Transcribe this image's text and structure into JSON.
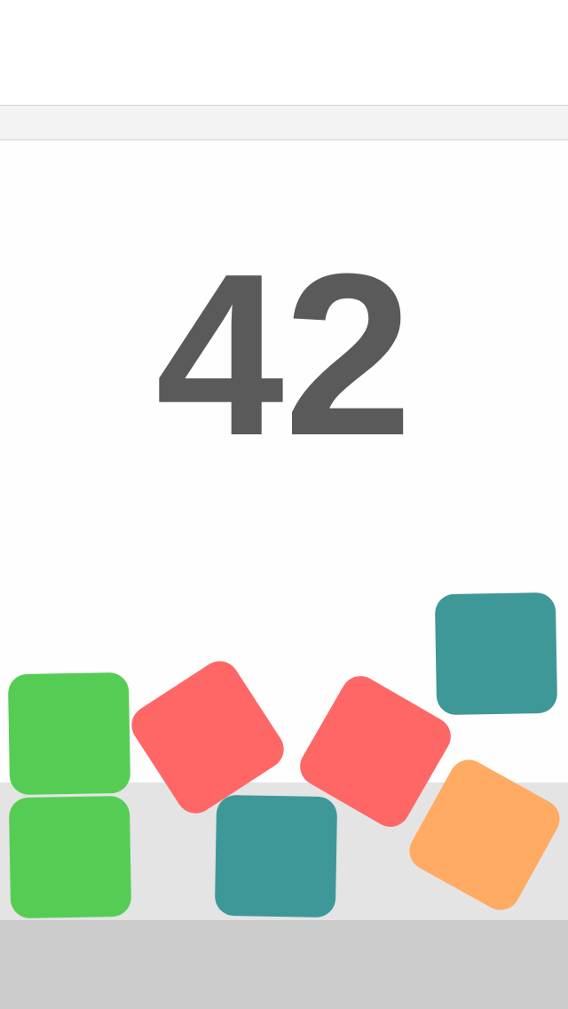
{
  "game": {
    "score": "42"
  },
  "colors": {
    "background": "#fefefe",
    "top_bar": "#f3f3f3",
    "score_text": "#5a5a5a",
    "ground_upper": "#e4e4e4",
    "ground_lower": "#cccccc",
    "green": "#55cd55",
    "red": "#ff6767",
    "teal": "#3e9898",
    "orange": "#ffab63"
  },
  "blocks": [
    {
      "id": "green-top",
      "color": "green"
    },
    {
      "id": "green-bottom",
      "color": "green"
    },
    {
      "id": "red-left",
      "color": "red"
    },
    {
      "id": "teal-middle",
      "color": "teal"
    },
    {
      "id": "red-right",
      "color": "red"
    },
    {
      "id": "teal-top-right",
      "color": "teal"
    },
    {
      "id": "orange-right",
      "color": "orange"
    }
  ]
}
